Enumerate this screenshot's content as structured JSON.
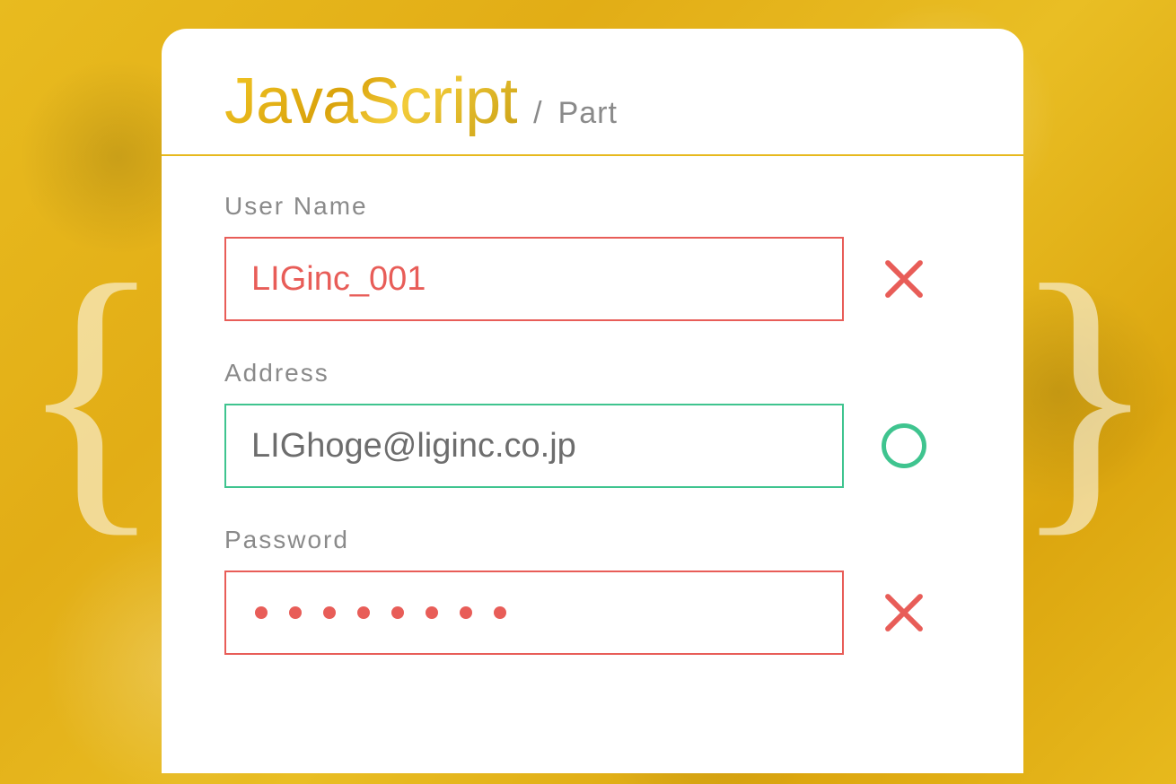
{
  "header": {
    "title": "JavaScript",
    "slash": "/",
    "part": "Part"
  },
  "form": {
    "username": {
      "label": "User Name",
      "value": "LIGinc_001",
      "status": "error"
    },
    "address": {
      "label": "Address",
      "value": "LIGhoge@liginc.co.jp",
      "status": "success"
    },
    "password": {
      "label": "Password",
      "dot_count": 8,
      "status": "error"
    }
  },
  "colors": {
    "accent": "#e7b91d",
    "error": "#e85d58",
    "success": "#3fc48f",
    "text_muted": "#8a8a8a"
  },
  "braces": {
    "left": "{",
    "right": "}"
  }
}
